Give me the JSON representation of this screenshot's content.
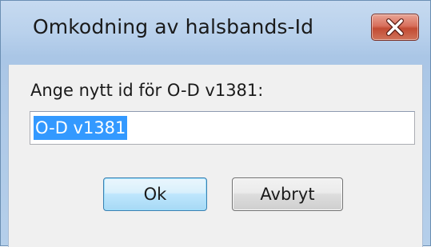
{
  "window": {
    "title": "Omkodning av halsbands-Id",
    "close_icon": "close-x-icon"
  },
  "form": {
    "prompt_label": "Ange nytt id för O-D v1381:",
    "id_value": "O-D v1381",
    "id_value_selected": true
  },
  "buttons": {
    "ok_label": "Ok",
    "cancel_label": "Avbryt"
  },
  "colors": {
    "selection": "#3399ff",
    "close_button": "#c24b33",
    "default_button_border": "#3c7fb1"
  }
}
